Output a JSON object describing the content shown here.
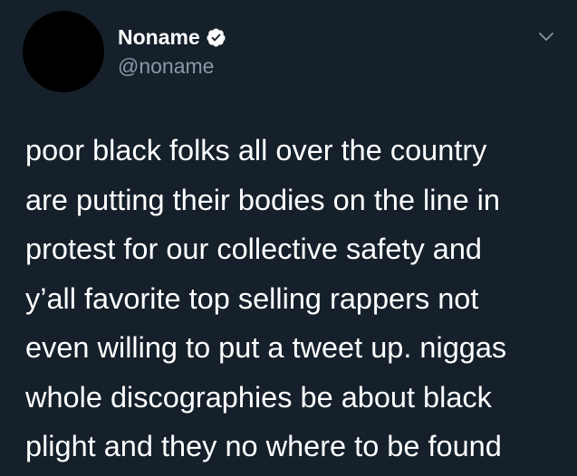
{
  "author": {
    "display_name": "Noname",
    "handle": "@noname",
    "verified": true,
    "verified_icon": "verified-badge-icon",
    "avatar_color": "#000000"
  },
  "menu": {
    "icon": "chevron-down-icon"
  },
  "tweet": {
    "lines": [
      "poor black folks all over the country",
      "are putting their bodies on the line in",
      "protest for our collective safety and",
      "y’all favorite top selling rappers not",
      "even willing to put a tweet up. niggas",
      "whole discographies be about black",
      "plight and they no where to be found"
    ]
  },
  "colors": {
    "background": "#15202b",
    "text": "#ffffff",
    "secondary_text": "#8899a6"
  }
}
